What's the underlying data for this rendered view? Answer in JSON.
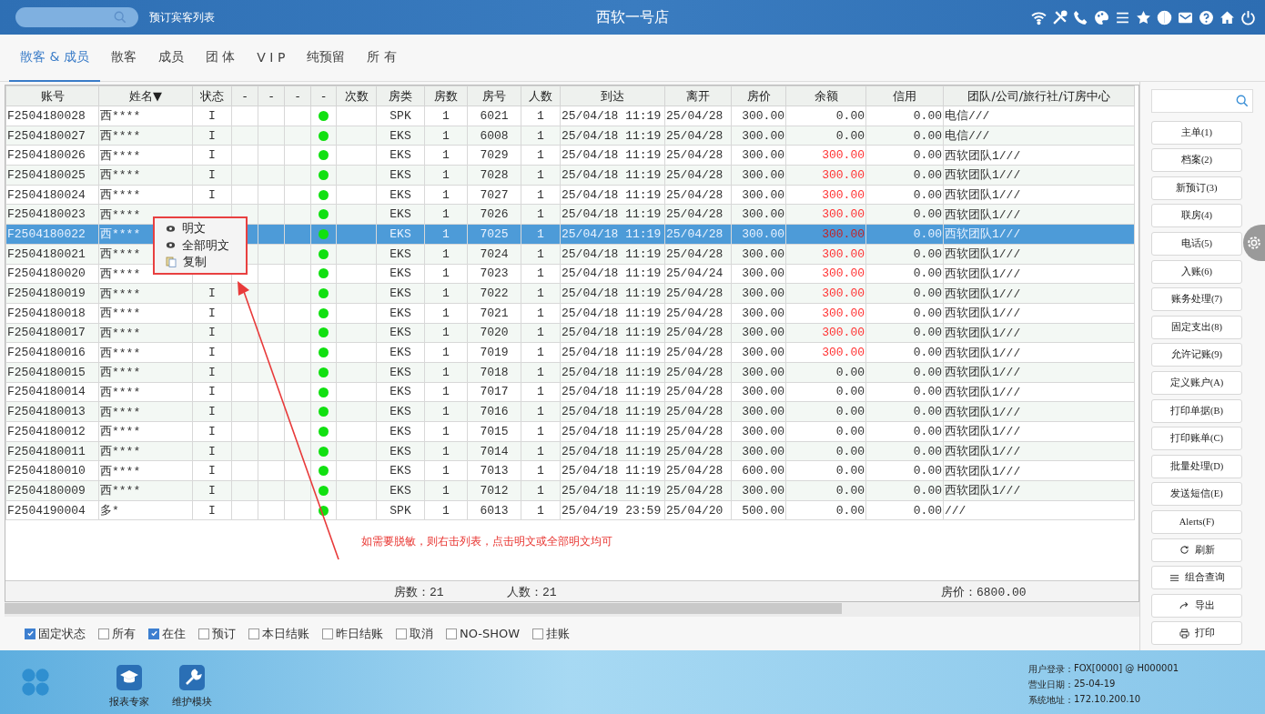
{
  "header": {
    "link": "预订宾客列表",
    "title": "西软一号店"
  },
  "tabs": [
    {
      "label": "散客 & 成员",
      "selected": true
    },
    {
      "label": "散客",
      "selected": false
    },
    {
      "label": "成员",
      "selected": false
    },
    {
      "label": "团 体",
      "selected": false
    },
    {
      "label": "V I P",
      "selected": false
    },
    {
      "label": "纯预留",
      "selected": false
    },
    {
      "label": "所 有",
      "selected": false
    }
  ],
  "table": {
    "columns": [
      "账号",
      "姓名▼",
      "状态",
      "-",
      "-",
      "-",
      "-",
      "次数",
      "房类",
      "房数",
      "房号",
      "人数",
      "到达",
      "离开",
      "房价",
      "余额",
      "信用",
      "团队/公司/旅行社/订房中心"
    ],
    "rows": [
      {
        "account": "F2504180028",
        "name": "西****",
        "status": "I",
        "type": "SPK",
        "rooms": "1",
        "room": "6021",
        "persons": "1",
        "arrival": "25/04/18 11:19",
        "departure": "25/04/28",
        "rate": "300.00",
        "balance": "0.00",
        "balance_due": false,
        "credit": "0.00",
        "group": "电信///",
        "selected": false
      },
      {
        "account": "F2504180027",
        "name": "西****",
        "status": "I",
        "type": "EKS",
        "rooms": "1",
        "room": "6008",
        "persons": "1",
        "arrival": "25/04/18 11:19",
        "departure": "25/04/28",
        "rate": "300.00",
        "balance": "0.00",
        "balance_due": false,
        "credit": "0.00",
        "group": "电信///",
        "selected": false
      },
      {
        "account": "F2504180026",
        "name": "西****",
        "status": "I",
        "type": "EKS",
        "rooms": "1",
        "room": "7029",
        "persons": "1",
        "arrival": "25/04/18 11:19",
        "departure": "25/04/28",
        "rate": "300.00",
        "balance": "300.00",
        "balance_due": true,
        "credit": "0.00",
        "group": "西软团队1///",
        "selected": false
      },
      {
        "account": "F2504180025",
        "name": "西****",
        "status": "I",
        "type": "EKS",
        "rooms": "1",
        "room": "7028",
        "persons": "1",
        "arrival": "25/04/18 11:19",
        "departure": "25/04/28",
        "rate": "300.00",
        "balance": "300.00",
        "balance_due": true,
        "credit": "0.00",
        "group": "西软团队1///",
        "selected": false
      },
      {
        "account": "F2504180024",
        "name": "西****",
        "status": "I",
        "type": "EKS",
        "rooms": "1",
        "room": "7027",
        "persons": "1",
        "arrival": "25/04/18 11:19",
        "departure": "25/04/28",
        "rate": "300.00",
        "balance": "300.00",
        "balance_due": true,
        "credit": "0.00",
        "group": "西软团队1///",
        "selected": false
      },
      {
        "account": "F2504180023",
        "name": "西****",
        "type": "EKS",
        "rooms": "1",
        "room": "7026",
        "persons": "1",
        "arrival": "25/04/18 11:19",
        "departure": "25/04/28",
        "rate": "300.00",
        "balance": "300.00",
        "balance_due": true,
        "credit": "0.00",
        "group": "西软团队1///",
        "selected": false
      },
      {
        "account": "F2504180022",
        "name": "西****",
        "type": "EKS",
        "rooms": "1",
        "room": "7025",
        "persons": "1",
        "arrival": "25/04/18 11:19",
        "departure": "25/04/28",
        "rate": "300.00",
        "balance": "300.00",
        "balance_due": true,
        "credit": "0.00",
        "group": "西软团队1///",
        "selected": true
      },
      {
        "account": "F2504180021",
        "name": "西****",
        "type": "EKS",
        "rooms": "1",
        "room": "7024",
        "persons": "1",
        "arrival": "25/04/18 11:19",
        "departure": "25/04/28",
        "rate": "300.00",
        "balance": "300.00",
        "balance_due": true,
        "credit": "0.00",
        "group": "西软团队1///",
        "selected": false
      },
      {
        "account": "F2504180020",
        "name": "西****",
        "type": "EKS",
        "rooms": "1",
        "room": "7023",
        "persons": "1",
        "arrival": "25/04/18 11:19",
        "departure": "25/04/24",
        "rate": "300.00",
        "balance": "300.00",
        "balance_due": true,
        "credit": "0.00",
        "group": "西软团队1///",
        "selected": false
      },
      {
        "account": "F2504180019",
        "name": "西****",
        "status": "I",
        "type": "EKS",
        "rooms": "1",
        "room": "7022",
        "persons": "1",
        "arrival": "25/04/18 11:19",
        "departure": "25/04/28",
        "rate": "300.00",
        "balance": "300.00",
        "balance_due": true,
        "credit": "0.00",
        "group": "西软团队1///",
        "selected": false
      },
      {
        "account": "F2504180018",
        "name": "西****",
        "status": "I",
        "type": "EKS",
        "rooms": "1",
        "room": "7021",
        "persons": "1",
        "arrival": "25/04/18 11:19",
        "departure": "25/04/28",
        "rate": "300.00",
        "balance": "300.00",
        "balance_due": true,
        "credit": "0.00",
        "group": "西软团队1///",
        "selected": false
      },
      {
        "account": "F2504180017",
        "name": "西****",
        "status": "I",
        "type": "EKS",
        "rooms": "1",
        "room": "7020",
        "persons": "1",
        "arrival": "25/04/18 11:19",
        "departure": "25/04/28",
        "rate": "300.00",
        "balance": "300.00",
        "balance_due": true,
        "credit": "0.00",
        "group": "西软团队1///",
        "selected": false
      },
      {
        "account": "F2504180016",
        "name": "西****",
        "status": "I",
        "type": "EKS",
        "rooms": "1",
        "room": "7019",
        "persons": "1",
        "arrival": "25/04/18 11:19",
        "departure": "25/04/28",
        "rate": "300.00",
        "balance": "300.00",
        "balance_due": true,
        "credit": "0.00",
        "group": "西软团队1///",
        "selected": false
      },
      {
        "account": "F2504180015",
        "name": "西****",
        "status": "I",
        "type": "EKS",
        "rooms": "1",
        "room": "7018",
        "persons": "1",
        "arrival": "25/04/18 11:19",
        "departure": "25/04/28",
        "rate": "300.00",
        "balance": "0.00",
        "balance_due": false,
        "credit": "0.00",
        "group": "西软团队1///",
        "selected": false
      },
      {
        "account": "F2504180014",
        "name": "西****",
        "status": "I",
        "type": "EKS",
        "rooms": "1",
        "room": "7017",
        "persons": "1",
        "arrival": "25/04/18 11:19",
        "departure": "25/04/28",
        "rate": "300.00",
        "balance": "0.00",
        "balance_due": false,
        "credit": "0.00",
        "group": "西软团队1///",
        "selected": false
      },
      {
        "account": "F2504180013",
        "name": "西****",
        "status": "I",
        "type": "EKS",
        "rooms": "1",
        "room": "7016",
        "persons": "1",
        "arrival": "25/04/18 11:19",
        "departure": "25/04/28",
        "rate": "300.00",
        "balance": "0.00",
        "balance_due": false,
        "credit": "0.00",
        "group": "西软团队1///",
        "selected": false
      },
      {
        "account": "F2504180012",
        "name": "西****",
        "status": "I",
        "type": "EKS",
        "rooms": "1",
        "room": "7015",
        "persons": "1",
        "arrival": "25/04/18 11:19",
        "departure": "25/04/28",
        "rate": "300.00",
        "balance": "0.00",
        "balance_due": false,
        "credit": "0.00",
        "group": "西软团队1///",
        "selected": false
      },
      {
        "account": "F2504180011",
        "name": "西****",
        "status": "I",
        "type": "EKS",
        "rooms": "1",
        "room": "7014",
        "persons": "1",
        "arrival": "25/04/18 11:19",
        "departure": "25/04/28",
        "rate": "300.00",
        "balance": "0.00",
        "balance_due": false,
        "credit": "0.00",
        "group": "西软团队1///",
        "selected": false
      },
      {
        "account": "F2504180010",
        "name": "西****",
        "status": "I",
        "type": "EKS",
        "rooms": "1",
        "room": "7013",
        "persons": "1",
        "arrival": "25/04/18 11:19",
        "departure": "25/04/28",
        "rate": "600.00",
        "balance": "0.00",
        "balance_due": false,
        "credit": "0.00",
        "group": "西软团队1///",
        "selected": false
      },
      {
        "account": "F2504180009",
        "name": "西****",
        "status": "I",
        "type": "EKS",
        "rooms": "1",
        "room": "7012",
        "persons": "1",
        "arrival": "25/04/18 11:19",
        "departure": "25/04/28",
        "rate": "300.00",
        "balance": "0.00",
        "balance_due": false,
        "credit": "0.00",
        "group": "西软团队1///",
        "selected": false
      },
      {
        "account": "F2504190004",
        "name": "多*",
        "status": "I",
        "type": "SPK",
        "rooms": "1",
        "room": "6013",
        "persons": "1",
        "arrival": "25/04/19 23:59",
        "departure": "25/04/20",
        "rate": "500.00",
        "balance": "0.00",
        "balance_due": false,
        "credit": "0.00",
        "group": "///",
        "selected": false
      }
    ],
    "summary": {
      "rooms": "房数：21",
      "persons": "人数：21",
      "rate": "房价：6800.00"
    }
  },
  "context_menu": [
    {
      "kind": "eye",
      "label": "明文"
    },
    {
      "kind": "eye",
      "label": "全部明文"
    },
    {
      "kind": "copy",
      "label": "复制"
    }
  ],
  "annotation": "如需要脱敏，则右击列表，点击明文或全部明文均可",
  "filters": [
    {
      "label": "固定状态",
      "checked": true
    },
    {
      "label": "所有",
      "checked": false
    },
    {
      "label": "在住",
      "checked": true
    },
    {
      "label": "预订",
      "checked": false
    },
    {
      "label": "本日结账",
      "checked": false
    },
    {
      "label": "昨日结账",
      "checked": false
    },
    {
      "label": "取消",
      "checked": false
    },
    {
      "label": "NO-SHOW",
      "checked": false
    },
    {
      "label": "挂账",
      "checked": false
    }
  ],
  "side_buttons": [
    {
      "kind": "plain",
      "label": "主单(1)"
    },
    {
      "kind": "plain",
      "label": "档案(2)"
    },
    {
      "kind": "plain",
      "label": "新预订(3)"
    },
    {
      "kind": "plain",
      "label": "联房(4)"
    },
    {
      "kind": "plain",
      "label": "电话(5)"
    },
    {
      "kind": "plain",
      "label": "入账(6)"
    },
    {
      "kind": "plain",
      "label": "账务处理(7)"
    },
    {
      "kind": "plain",
      "label": "固定支出(8)"
    },
    {
      "kind": "plain",
      "label": "允许记账(9)"
    },
    {
      "kind": "plain",
      "label": "定义账户(A)"
    },
    {
      "kind": "plain",
      "label": "打印单据(B)"
    },
    {
      "kind": "plain",
      "label": "打印账单(C)"
    },
    {
      "kind": "plain",
      "label": "批量处理(D)"
    },
    {
      "kind": "plain",
      "label": "发送短信(E)"
    },
    {
      "kind": "plain",
      "label": "Alerts(F)"
    },
    {
      "kind": "refresh",
      "label": "刷新"
    },
    {
      "kind": "list",
      "label": "组合查询"
    },
    {
      "kind": "export",
      "label": "导出"
    },
    {
      "kind": "print",
      "label": "打印"
    }
  ],
  "footer": {
    "apps": [
      {
        "kind": "report",
        "label": "报表专家"
      },
      {
        "kind": "tool",
        "label": "维护模块"
      }
    ],
    "info": [
      {
        "label": "用户登录：",
        "value": "FOX[0000] @ H000001"
      },
      {
        "label": "营业日期：",
        "value": "25-04-19"
      },
      {
        "label": "系统地址：",
        "value": "172.10.200.10"
      }
    ]
  }
}
